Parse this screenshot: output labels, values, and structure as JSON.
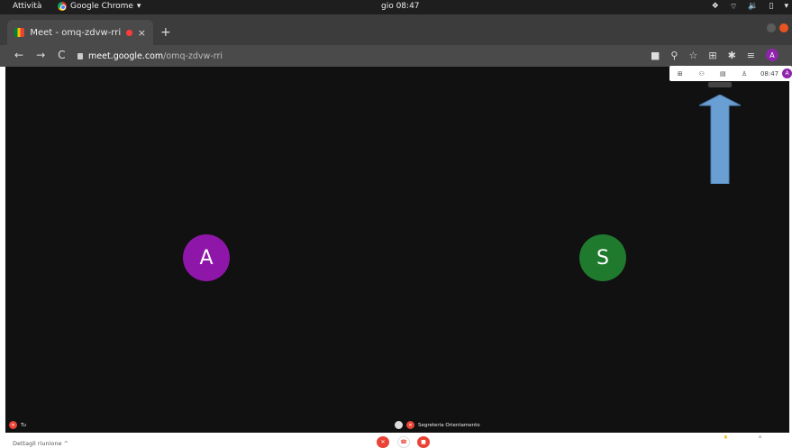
{
  "system_bar": {
    "activities": "Attività",
    "app_name": "Google Chrome",
    "app_menu_arrow": "▾",
    "clock": "gio 08:47",
    "tray_icons": [
      "dropbox-icon",
      "wifi-icon",
      "volume-icon",
      "battery-icon",
      "menu-arrow-icon"
    ]
  },
  "tab": {
    "title": "Meet - omq-zdvw-rri",
    "close": "×",
    "new_tab": "+"
  },
  "toolbar": {
    "back": "←",
    "forward": "→",
    "reload": "C",
    "url_host": "meet.google.com",
    "url_path": "/omq-zdvw-rri",
    "avatar_letter": "A"
  },
  "meet_panel": {
    "time": "08:47",
    "avatar_letter": "A"
  },
  "participants": [
    {
      "initial": "A",
      "color": "#8e16a8"
    },
    {
      "initial": "S",
      "color": "#1f7a2e"
    }
  ],
  "labels": {
    "self": "Tu",
    "other": "Segreteria Orientamento"
  },
  "bottom_bar": {
    "details": "Dettagli riunione",
    "details_arrow": "^"
  },
  "colors": {
    "stage": "#111111",
    "annotation_arrow": "#6a9fd4",
    "danger": "#ea4335"
  }
}
